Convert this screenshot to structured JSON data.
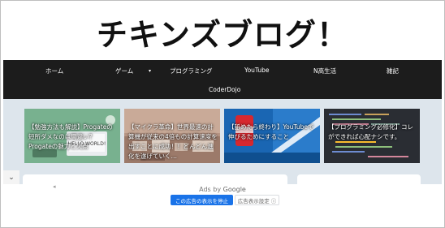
{
  "header": {
    "title": "チキンズブログ！"
  },
  "nav": {
    "items": [
      {
        "label": "ホーム"
      },
      {
        "label": "ゲーム"
      },
      {
        "label": "プログラミング"
      },
      {
        "label": "YouTube"
      },
      {
        "label": "N高生活"
      },
      {
        "label": "雑記"
      },
      {
        "label": "CoderDojo"
      }
    ]
  },
  "cards": [
    {
      "title": "【勉強方法も解説】Progateの短所ダメなのは間違い？Progateの魅力と欠点",
      "image_text": "HELLO WORLD!"
    },
    {
      "title": "【マイクラ革命】世界最速の計算機が従来の4倍もの計算速度を出すことに成功！！どんどん進化を遂げていく…",
      "image_text": ""
    },
    {
      "title": "【舐めたら終わり】YouTubeで伸びるためにすること",
      "image_text": ""
    },
    {
      "title": "【プログラミング必修化】コレができれば心配ナシです。",
      "image_text": ""
    }
  ],
  "ad": {
    "ads_by": "Ads by",
    "google": "Google",
    "back_icon": "back-arrow",
    "stop_label": "この広告の表示を停止",
    "settings_label": "広告表示設定",
    "settings_icon": "info-circle"
  },
  "colors": {
    "nav_bg": "#1c1c1c",
    "content_bg": "#dde5ec",
    "button_blue": "#1a73e8"
  }
}
